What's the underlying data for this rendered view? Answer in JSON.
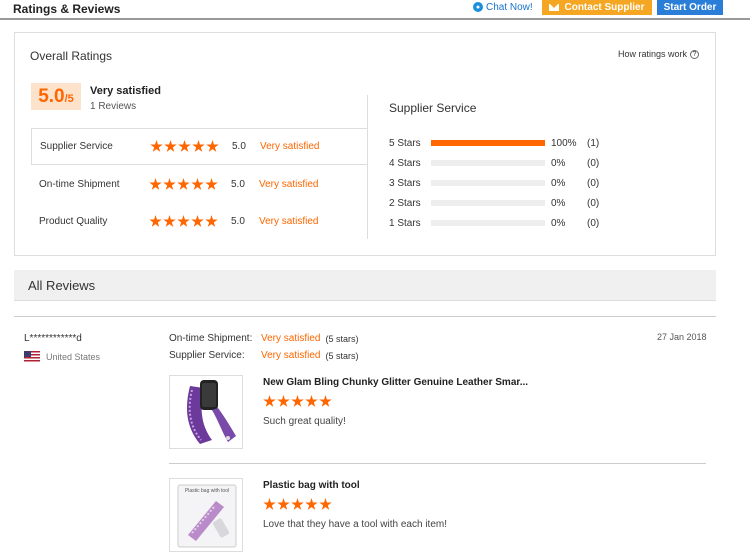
{
  "header": {
    "title": "Ratings & Reviews",
    "chat_label": "Chat Now!",
    "contact_label": "Contact Supplier",
    "start_order_label": "Start Order"
  },
  "overall": {
    "heading": "Overall Ratings",
    "how_label": "How ratings work",
    "score": "5.0",
    "score_max": "/5",
    "verdict": "Very satisfied",
    "reviews_count": "1 Reviews",
    "categories": [
      {
        "label": "Supplier Service",
        "rating": 5,
        "value": "5.0",
        "verdict": "Very satisfied"
      },
      {
        "label": "On-time Shipment",
        "rating": 5,
        "value": "5.0",
        "verdict": "Very satisfied"
      },
      {
        "label": "Product Quality",
        "rating": 5,
        "value": "5.0",
        "verdict": "Very satisfied"
      }
    ]
  },
  "supplier_service": {
    "title": "Supplier Service",
    "distribution": [
      {
        "label": "5 Stars",
        "fraction": 1.0,
        "percent": "100%",
        "count": "(1)"
      },
      {
        "label": "4 Stars",
        "fraction": 0,
        "percent": "0%",
        "count": "(0)"
      },
      {
        "label": "3 Stars",
        "fraction": 0,
        "percent": "0%",
        "count": "(0)"
      },
      {
        "label": "2 Stars",
        "fraction": 0,
        "percent": "0%",
        "count": "(0)"
      },
      {
        "label": "1 Stars",
        "fraction": 0,
        "percent": "0%",
        "count": "(0)"
      }
    ]
  },
  "all_reviews": {
    "heading": "All Reviews",
    "review": {
      "reviewer": "L************d",
      "country": "United States",
      "date": "27 Jan 2018",
      "ratings": [
        {
          "key": "On-time Shipment:",
          "verdict": "Very satisfied",
          "stars": "(5 stars)"
        },
        {
          "key": "Supplier Service:",
          "verdict": "Very satisfied",
          "stars": "(5 stars)"
        }
      ],
      "products": [
        {
          "name": "New Glam Bling Chunky Glitter Genuine Leather Smar...",
          "rating": 5,
          "comment": "Such great quality!"
        },
        {
          "name": "Plastic bag with tool",
          "rating": 5,
          "comment": "Love that they have a tool with each item!",
          "thumb_text": "Plastic bag with tool"
        }
      ]
    }
  },
  "colors": {
    "accent": "#ff6600",
    "contact_button": "#f5a623",
    "start_button": "#2a7ed8"
  }
}
